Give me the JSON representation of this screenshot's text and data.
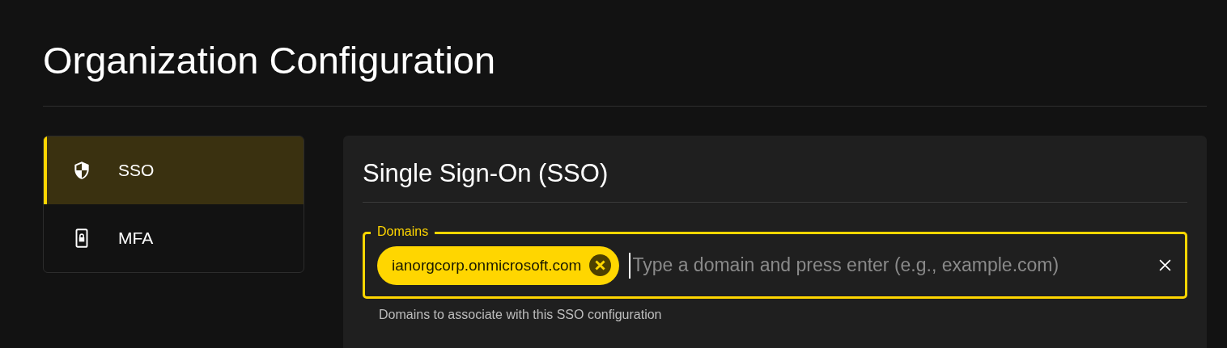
{
  "page": {
    "title": "Organization Configuration"
  },
  "sidebar": {
    "items": [
      {
        "label": "SSO",
        "kind": "shield",
        "selected": true
      },
      {
        "label": "MFA",
        "kind": "phone-lock",
        "selected": false
      }
    ]
  },
  "panel": {
    "title": "Single Sign-On (SSO)",
    "domains_field": {
      "label": "Domains",
      "chips": [
        "ianorgcorp.onmicrosoft.com"
      ],
      "placeholder": "Type a domain and press enter (e.g., example.com)",
      "helper": "Domains to associate with this SSO configuration"
    }
  }
}
